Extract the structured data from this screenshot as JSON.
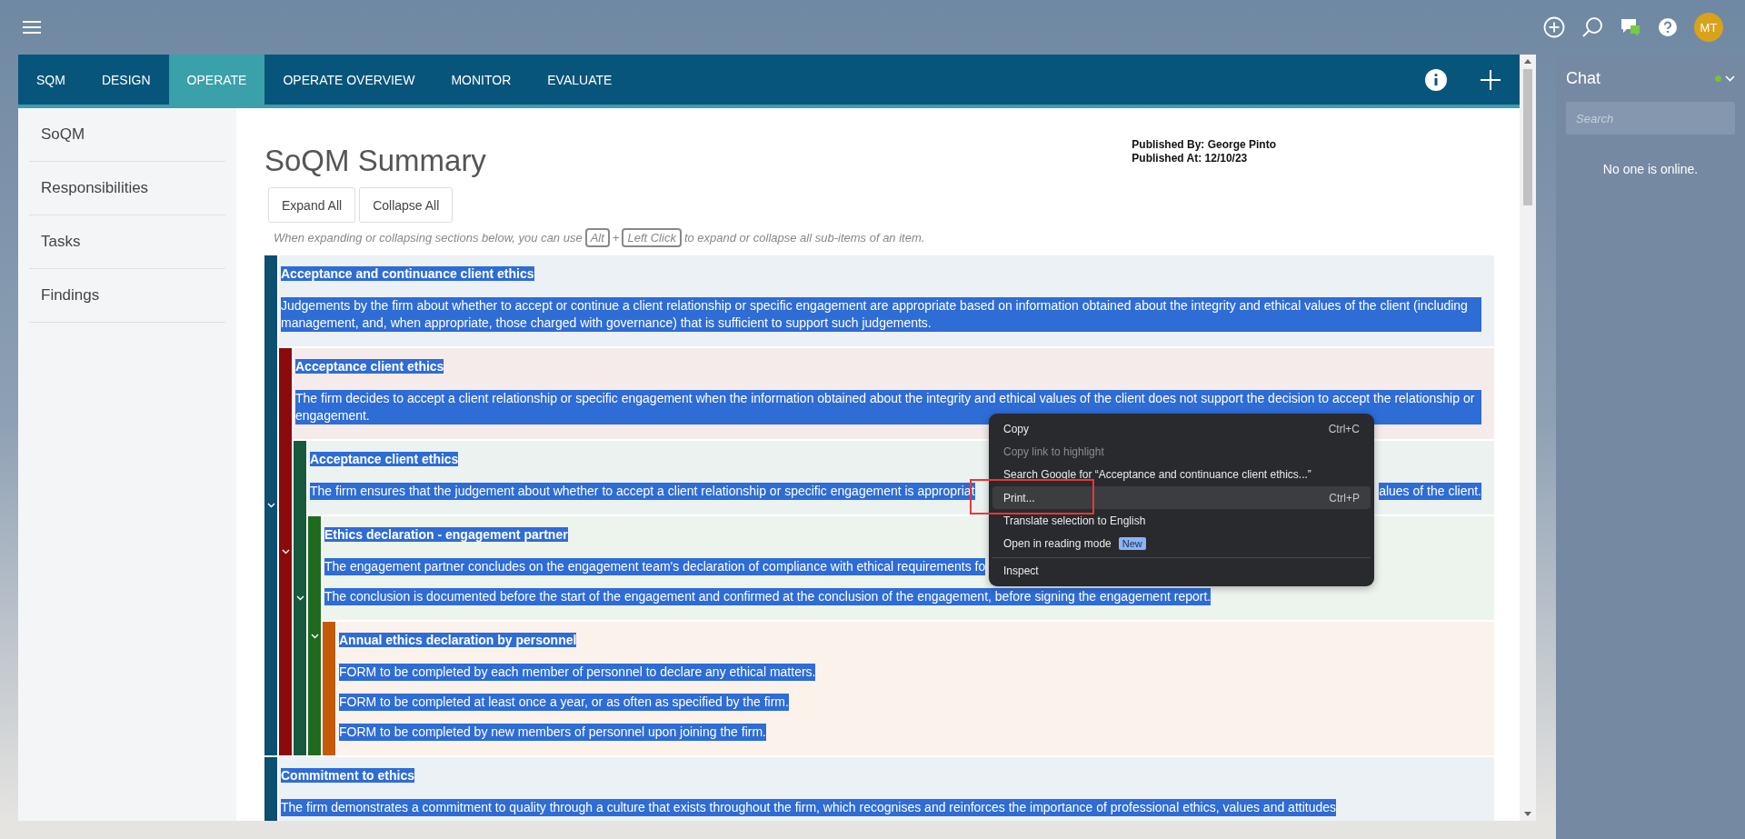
{
  "user": {
    "initials": "MT"
  },
  "tabs": [
    {
      "label": "SQM",
      "selected": false
    },
    {
      "label": "DESIGN",
      "selected": false
    },
    {
      "label": "OPERATE",
      "selected": true
    },
    {
      "label": "OPERATE OVERVIEW",
      "selected": false
    },
    {
      "label": "MONITOR",
      "selected": false
    },
    {
      "label": "EVALUATE",
      "selected": false
    }
  ],
  "sidebar": {
    "items": [
      {
        "label": "SoQM",
        "selected": false
      },
      {
        "label": "Responsibilities",
        "selected": false
      },
      {
        "label": "Tasks",
        "selected": false
      },
      {
        "label": "Findings",
        "selected": false
      }
    ]
  },
  "page": {
    "title": "SoQM Summary",
    "published_by": "Published By: George Pinto",
    "published_at": "Published At: 12/10/23",
    "buttons": [
      "Expand All",
      "Collapse All"
    ],
    "hint": {
      "before": "When expanding or collapsing sections below, you can use",
      "key_1": "Alt",
      "plus": "+",
      "key_2": "Left Click",
      "after": "to expand or collapse all sub-items of an item."
    }
  },
  "tree": [
    {
      "title": "Acceptance and continuance client ethics",
      "color": "#0b4f71",
      "paragraphs": [
        [
          "Judgements by the firm about whether to accept or continue a client relationship or specific engagement are appropriate based on information obtained about the integrity and ethical values of the client (including management, and, when appropriate, those charged with governance) that is sufficient to support such judgements."
        ]
      ],
      "children": [
        {
          "title": "Acceptance client ethics",
          "color": "#8b0a0a",
          "paragraphs": [
            [
              "The firm decides to accept a client relationship or specific engagement when the information obtained about the integrity and ethical values of the client does not support the decision to accept the relationship or engagement."
            ]
          ],
          "children": [
            {
              "title": "Acceptance client ethics",
              "color": "#175a3c",
              "paragraphs": [
                [
                  "The firm ensures that the judgement about whether to accept a client relationship or specific engagement is appropriat",
                  "alues of the client."
                ]
              ],
              "children": [
                {
                  "title": "Ethics declaration - engagement partner",
                  "color": "#1f6a1f",
                  "paragraphs": [
                    [
                      "The engagement partner concludes on the engagement team's declaration of compliance with ethical requirements fo"
                    ],
                    [
                      "The conclusion is documented before the start of the engagement and confirmed at the conclusion of the engagement, before signing the engagement report."
                    ]
                  ],
                  "children": [
                    {
                      "title": "Annual ethics declaration by personnel",
                      "color": "#c45a0a",
                      "paragraphs": [
                        [
                          "FORM to be completed by each member of personnel to declare any ethical matters."
                        ],
                        [
                          "FORM to be completed at least once a year, or as often as specified by the firm."
                        ],
                        [
                          "FORM to be completed by new members of personnel upon joining the firm."
                        ]
                      ]
                    }
                  ]
                }
              ]
            }
          ]
        }
      ]
    },
    {
      "title": "Commitment to ethics",
      "color": "#0b4f71",
      "paragraphs": [
        [
          "The firm demonstrates a commitment to quality through a culture that exists throughout the firm, which recognises and reinforces the importance of professional ethics, values and attitudes"
        ]
      ]
    }
  ],
  "context_menu": {
    "items": [
      {
        "kind": "item",
        "label": "Copy",
        "shortcut": "Ctrl+C",
        "disabled": false,
        "selected": false
      },
      {
        "kind": "item",
        "label": "Copy link to highlight",
        "disabled": true,
        "selected": false
      },
      {
        "kind": "item",
        "label": "Search Google for “Acceptance and continuance client ethics...”",
        "disabled": false,
        "selected": false
      },
      {
        "kind": "item",
        "label": "Print...",
        "shortcut": "Ctrl+P",
        "disabled": false,
        "selected": true
      },
      {
        "kind": "item",
        "label": "Translate selection to English",
        "disabled": false,
        "selected": false
      },
      {
        "kind": "item",
        "label": "Open in reading mode",
        "badge": "New",
        "disabled": false,
        "selected": false
      },
      {
        "kind": "separator"
      },
      {
        "kind": "item",
        "label": "Inspect",
        "disabled": false,
        "selected": false
      }
    ]
  },
  "chat": {
    "title": "Chat",
    "online": true,
    "search": {
      "placeholder": "Search"
    },
    "empty_text": "No one is online."
  }
}
